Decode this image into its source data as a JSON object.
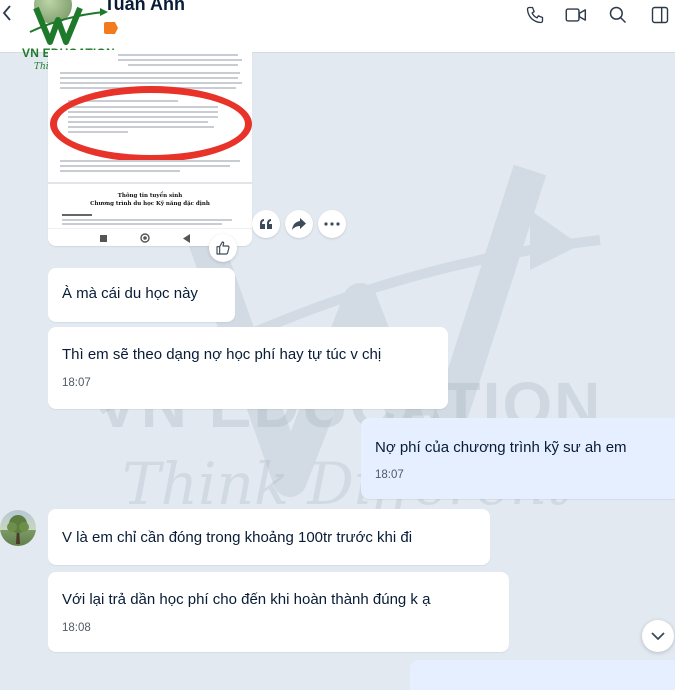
{
  "header": {
    "contact_name": "Tuấn Anh",
    "tag_color": "#f27b1e",
    "icons": [
      "back-icon",
      "phone-icon",
      "video-icon",
      "search-icon",
      "sidebar-toggle-icon"
    ]
  },
  "logo": {
    "brand": "VN EDUCATION",
    "tagline": "Think Different",
    "color": "#1e7a2a"
  },
  "watermark": {
    "line1": "VN EDUCATION",
    "line2": "Think Different"
  },
  "shared_document": {
    "title_line1": "Thông tin tuyển sinh",
    "title_line2": "Chương trình du học Kỹ năng đặc định",
    "highlight_color": "#e8332a",
    "reactions": [
      "quote-icon",
      "forward-icon",
      "more-icon"
    ],
    "like_icon": "thumbs-up-icon"
  },
  "messages": [
    {
      "side": "them",
      "text": "À mà cái du học này",
      "time": ""
    },
    {
      "side": "them",
      "text": "Thì em sẽ theo dạng nợ học phí hay tự túc v chị",
      "time": "18:07"
    },
    {
      "side": "me",
      "text": "Nợ phí của chương trình kỹ sư ah em",
      "time": "18:07"
    },
    {
      "side": "them",
      "text": "V là em chỉ cần đóng trong khoảng 100tr trước khi đi",
      "time": ""
    },
    {
      "side": "them",
      "text": "Với lại trả dần học phí cho đến khi hoàn thành đúng k ạ",
      "time": "18:08"
    }
  ],
  "colors": {
    "background": "#e2e9f1",
    "bubble_them": "#ffffff",
    "bubble_me": "#e5efff",
    "text": "#081c36",
    "time": "#4e5a66"
  }
}
